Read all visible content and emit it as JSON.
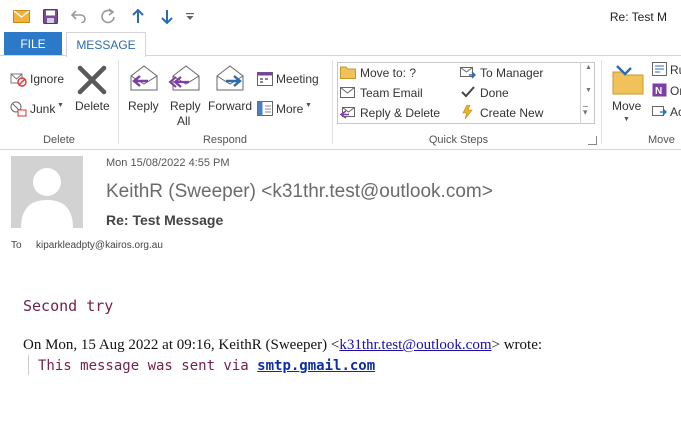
{
  "title_bar": {
    "title": "Re: Test M"
  },
  "tabs": {
    "file": "FILE",
    "message": "MESSAGE"
  },
  "ribbon": {
    "delete_group": {
      "ignore": "Ignore",
      "junk": "Junk",
      "delete": "Delete",
      "label": "Delete"
    },
    "respond_group": {
      "reply": "Reply",
      "reply_all_1": "Reply",
      "reply_all_2": "All",
      "forward": "Forward",
      "meeting": "Meeting",
      "more": "More",
      "label": "Respond"
    },
    "quick_steps": {
      "items": [
        "Move to: ?",
        "To Manager",
        "Team Email",
        "Done",
        "Reply & Delete",
        "Create New"
      ],
      "label": "Quick Steps"
    },
    "move_group": {
      "move": "Move",
      "label": "Move",
      "rules": "Ru",
      "onenote": "On",
      "actions": "Ac"
    }
  },
  "header": {
    "date": "Mon 15/08/2022 4:55 PM",
    "sender": "KeithR (Sweeper) <k31thr.test@outlook.com>",
    "subject": "Re: Test Message",
    "to_label": "To",
    "to_value": "kiparkleadpty@kairos.org.au"
  },
  "body": {
    "line1": "Second try",
    "wrote_prefix": "On Mon, 15 Aug 2022 at 09:16, KeithR (Sweeper) <",
    "wrote_email": "k31thr.test@outlook.com",
    "wrote_suffix": "> wrote:",
    "quote_prefix": "This message was sent via ",
    "quote_link": "smtp.gmail.com"
  },
  "colors": {
    "accent": "#2b79c7",
    "body_text": "#74214c",
    "link": "#1a0dab"
  }
}
